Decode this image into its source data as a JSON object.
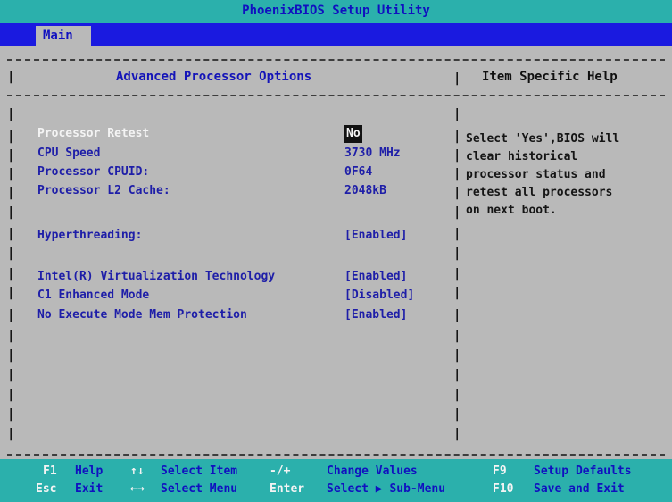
{
  "window": {
    "title": "PhoenixBIOS Setup Utility"
  },
  "menu": {
    "active_tab": "Main"
  },
  "panel": {
    "title": "Advanced Processor Options",
    "help_title": "Item Specific Help",
    "help_text": "Select 'Yes',BIOS will\nclear historical\nprocessor status and\nretest all processors\non next boot."
  },
  "settings": [
    {
      "label": "Processor Retest",
      "value": "No",
      "selected": true
    },
    {
      "label": "CPU Speed",
      "value": "3730 MHz"
    },
    {
      "label": "Processor CPUID:",
      "value": "0F64"
    },
    {
      "label": "Processor L2 Cache:",
      "value": "2048kB"
    },
    {
      "label": "Hyperthreading:",
      "value": "[Enabled]"
    },
    {
      "label": "Intel(R) Virtualization Technology",
      "value": "[Enabled]"
    },
    {
      "label": "C1 Enhanced Mode",
      "value": "[Disabled]"
    },
    {
      "label": "No Execute Mode Mem Protection",
      "value": "[Enabled]"
    }
  ],
  "footer": {
    "row1": [
      {
        "key": "F1",
        "desc": "Help"
      },
      {
        "key": "↑↓",
        "desc": "Select Item"
      },
      {
        "key": "-/+",
        "desc": "Change Values"
      },
      {
        "key": "F9",
        "desc": "Setup Defaults"
      }
    ],
    "row2": [
      {
        "key": "Esc",
        "desc": "Exit"
      },
      {
        "key": "←→",
        "desc": "Select Menu"
      },
      {
        "key": "Enter",
        "desc": "Select ▶ Sub-Menu"
      },
      {
        "key": "F10",
        "desc": "Save and Exit"
      }
    ]
  },
  "colors": {
    "title_bar": "#2bb0ac",
    "menu_bar": "#1a1ae0",
    "background": "#b9b9b9",
    "label_text": "#1e1ea8"
  }
}
